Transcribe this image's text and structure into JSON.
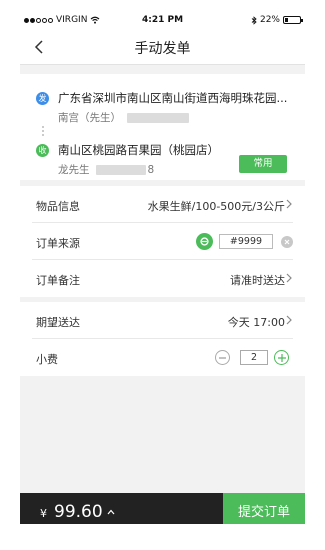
{
  "status_bar": {
    "carrier": "VIRGIN",
    "time": "4:21 PM",
    "battery": "22%",
    "signal_icon": "signal-dots-icon",
    "wifi_icon": "wifi-icon",
    "bluetooth_icon": "bluetooth-icon",
    "battery_level": 0.22
  },
  "nav": {
    "title": "手动发单",
    "back_icon": "chevron-left-icon"
  },
  "addresses": {
    "sender": {
      "badge": "发",
      "address": "广东省深圳市南山区南山街道西海明珠花园...",
      "contact": "南宫（先生）"
    },
    "receiver": {
      "badge": "收",
      "address": "南山区桃园路百果园（桃园店）",
      "contact": "龙先生",
      "contact_suffix": "8",
      "common_button": "常用"
    }
  },
  "order_info": {
    "goods": {
      "label": "物品信息",
      "value": "水果生鲜/100-500元/3公斤"
    },
    "source": {
      "label": "订单来源",
      "order_no": "#9999"
    },
    "note": {
      "label": "订单备注",
      "value": "请准时送达"
    }
  },
  "delivery": {
    "expected": {
      "label": "期望送达",
      "value": "今天 17:00"
    },
    "tip": {
      "label": "小费",
      "quantity": "2"
    }
  },
  "bottom": {
    "currency": "¥",
    "amount": "99.60",
    "submit": "提交订单"
  },
  "colors": {
    "brand_green": "#4cbb5a",
    "sender_blue": "#3d8ee8",
    "bottom_dark": "#222222"
  }
}
